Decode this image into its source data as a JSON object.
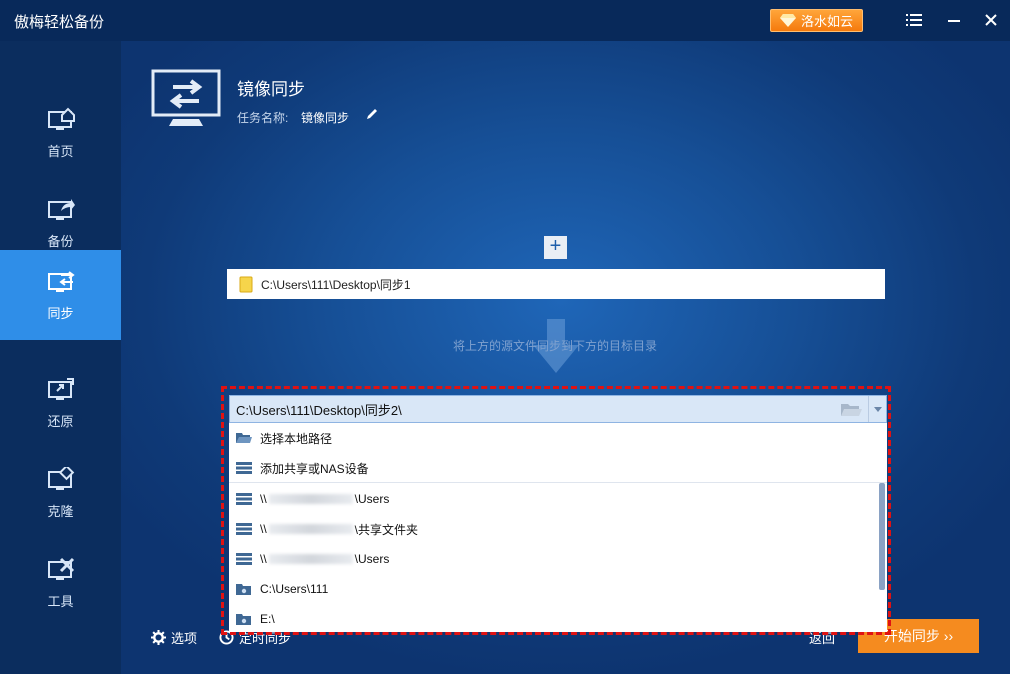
{
  "titlebar": {
    "app_title": "傲梅轻松备份",
    "upgrade_label": "洛水如云"
  },
  "sidebar": {
    "items": [
      {
        "label": "首页",
        "icon": "home-monitor-icon"
      },
      {
        "label": "备份",
        "icon": "backup-monitor-icon"
      },
      {
        "label": "同步",
        "icon": "sync-monitor-icon",
        "active": true
      },
      {
        "label": "还原",
        "icon": "restore-monitor-icon"
      },
      {
        "label": "克隆",
        "icon": "clone-monitor-icon"
      },
      {
        "label": "工具",
        "icon": "tools-monitor-icon"
      }
    ]
  },
  "header": {
    "title": "镜像同步",
    "task_name_label": "任务名称:",
    "task_name_value": "镜像同步"
  },
  "source": {
    "path": "C:\\Users\\111\\Desktop\\同步1"
  },
  "hint": "将上方的源文件同步到下方的目标目录",
  "destination": {
    "selected": "C:\\Users\\111\\Desktop\\同步2\\",
    "options": [
      {
        "label": "选择本地路径",
        "icon": "folder-open-icon"
      },
      {
        "label": "添加共享或NAS设备",
        "icon": "nas-server-icon"
      }
    ],
    "recent": [
      {
        "prefix": "\\\\",
        "suffix": "\\Users",
        "icon": "nas-server-icon"
      },
      {
        "prefix": "\\\\",
        "suffix": "\\共享文件夹",
        "icon": "nas-server-icon"
      },
      {
        "prefix": "\\\\",
        "suffix": "\\Users",
        "icon": "nas-server-icon"
      },
      {
        "label": "C:\\Users\\111",
        "icon": "network-folder-icon"
      },
      {
        "label": "E:\\",
        "icon": "network-folder-icon"
      }
    ]
  },
  "footer": {
    "options_label": "选项",
    "schedule_label": "定时同步",
    "back_label": "返回",
    "start_label": "开始同步 ››"
  },
  "colors": {
    "accent_orange": "#f58b1f",
    "sidebar_active": "#2f8ee8",
    "highlight_red": "#e01212"
  }
}
